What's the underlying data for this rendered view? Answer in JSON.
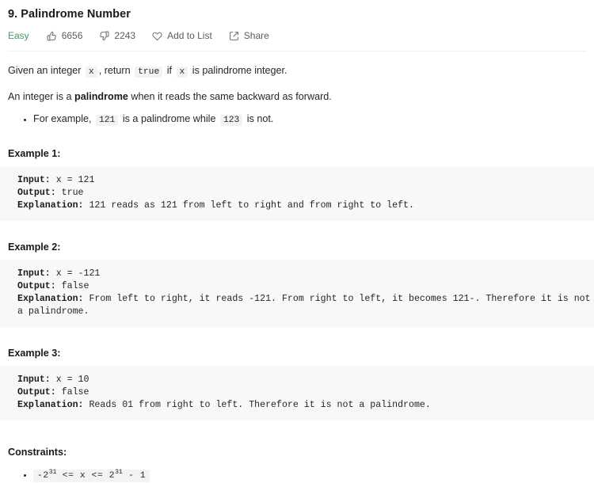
{
  "problem": {
    "title": "9. Palindrome Number",
    "difficulty": "Easy",
    "difficulty_color": "#3fa05e",
    "likes": "6656",
    "dislikes": "2243",
    "add_to_list_label": "Add to List",
    "share_label": "Share"
  },
  "description": {
    "line1_a": "Given an integer ",
    "line1_code_x1": "x",
    "line1_b": ", return ",
    "line1_code_true": "true",
    "line1_c": " if ",
    "line1_code_x2": "x",
    "line1_d": " is palindrome integer.",
    "line2_a": "An integer is a ",
    "line2_bold": "palindrome",
    "line2_b": " when it reads the same backward as forward.",
    "bullet_a": "For example, ",
    "bullet_code_1": "121",
    "bullet_b": " is a palindrome while ",
    "bullet_code_2": "123",
    "bullet_c": " is not."
  },
  "examples": [
    {
      "heading": "Example 1:",
      "input_label": "Input:",
      "input_value": " x = 121",
      "output_label": "Output:",
      "output_value": " true",
      "explanation_label": "Explanation:",
      "explanation_value": " 121 reads as 121 from left to right and from right to left."
    },
    {
      "heading": "Example 2:",
      "input_label": "Input:",
      "input_value": " x = -121",
      "output_label": "Output:",
      "output_value": " false",
      "explanation_label": "Explanation:",
      "explanation_value": " From left to right, it reads -121. From right to left, it becomes 121-. Therefore it is not a palindrome."
    },
    {
      "heading": "Example 3:",
      "input_label": "Input:",
      "input_value": " x = 10",
      "output_label": "Output:",
      "output_value": " false",
      "explanation_label": "Explanation:",
      "explanation_value": " Reads 01 from right to left. Therefore it is not a palindrome."
    }
  ],
  "constraints": {
    "heading": "Constraints:",
    "item": {
      "prefix": "-2",
      "exp1": "31",
      "middle": " <= x <= 2",
      "exp2": "31",
      "suffix": " - 1"
    }
  }
}
